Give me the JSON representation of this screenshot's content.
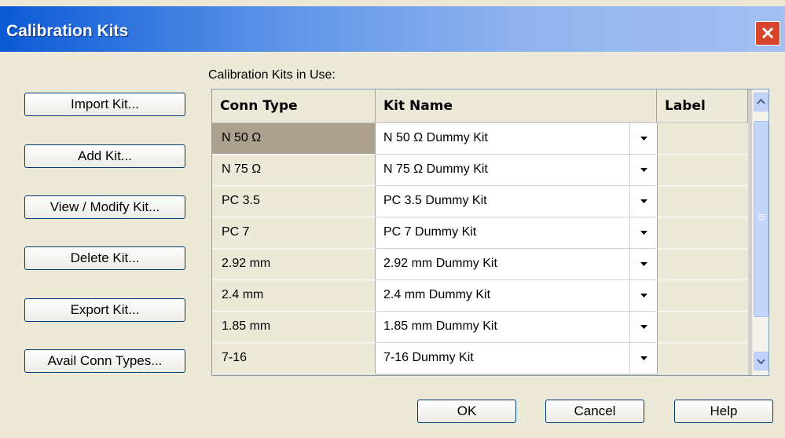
{
  "window": {
    "title": "Calibration Kits",
    "close_icon": "close-icon"
  },
  "sidebar": {
    "buttons": [
      {
        "label": "Import Kit..."
      },
      {
        "label": "Add Kit..."
      },
      {
        "label": "View / Modify Kit..."
      },
      {
        "label": "Delete Kit..."
      },
      {
        "label": "Export Kit..."
      },
      {
        "label": "Avail Conn Types..."
      }
    ]
  },
  "kits_list": {
    "label": "Calibration Kits in Use:",
    "columns": {
      "conn_type": "Conn Type",
      "kit_name": "Kit Name",
      "label": "Label"
    },
    "rows": [
      {
        "conn_type": "N 50 Ω",
        "kit_name": "N 50 Ω Dummy Kit",
        "label": ""
      },
      {
        "conn_type": "N 75 Ω",
        "kit_name": "N 75 Ω Dummy Kit",
        "label": ""
      },
      {
        "conn_type": "PC 3.5",
        "kit_name": "PC 3.5 Dummy Kit",
        "label": ""
      },
      {
        "conn_type": "PC 7",
        "kit_name": "PC 7 Dummy Kit",
        "label": ""
      },
      {
        "conn_type": "2.92 mm",
        "kit_name": "2.92 mm Dummy Kit",
        "label": ""
      },
      {
        "conn_type": "2.4 mm",
        "kit_name": "2.4 mm Dummy Kit",
        "label": ""
      },
      {
        "conn_type": "1.85 mm",
        "kit_name": "1.85 mm Dummy Kit",
        "label": ""
      },
      {
        "conn_type": "7-16",
        "kit_name": "7-16 Dummy Kit",
        "label": ""
      }
    ],
    "selected_row": 0
  },
  "footer": {
    "ok_label": "OK",
    "cancel_label": "Cancel",
    "help_label": "Help"
  },
  "colors": {
    "title_bar": "#0a5ad6",
    "dialog_bg": "#ece9d8",
    "selected_cell": "#aca08e",
    "close_button": "#d9432a"
  }
}
